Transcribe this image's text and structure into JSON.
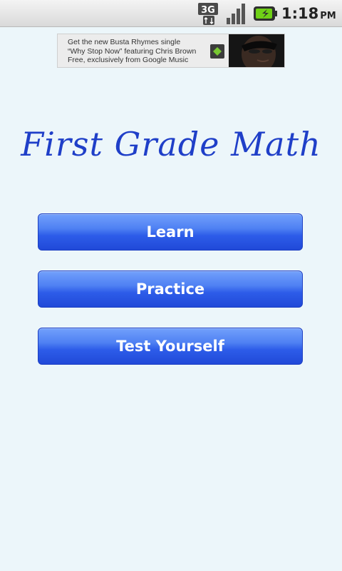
{
  "status_bar": {
    "network_label": "3G",
    "time": "1:18",
    "ampm": "PM",
    "icons": [
      "network-3g-icon",
      "signal-icon",
      "battery-icon"
    ]
  },
  "ad": {
    "line1": "Get the new Busta Rhymes single",
    "line2": "“Why Stop Now” featuring Chris Brown",
    "line3": "Free, exclusively from Google Music",
    "icon": "play-store-icon"
  },
  "title": "First Grade Math",
  "buttons": {
    "learn": "Learn",
    "practice": "Practice",
    "test": "Test Yourself"
  },
  "colors": {
    "background": "#ecf6fa",
    "title": "#1f3fc8",
    "button": "#2d5ce9"
  }
}
